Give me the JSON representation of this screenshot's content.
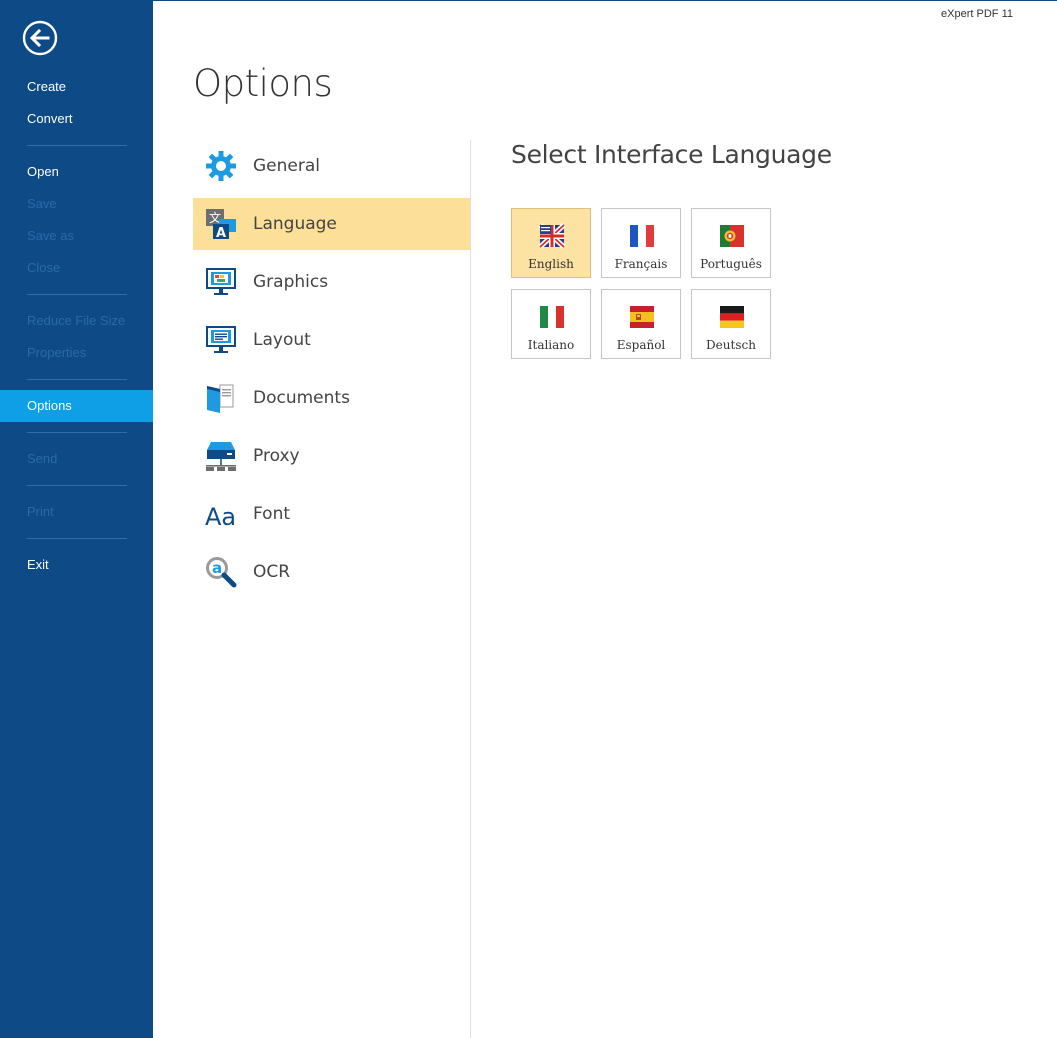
{
  "app": {
    "brand": "eXpert PDF 11",
    "page_title": "Options"
  },
  "sidebar": {
    "items": [
      {
        "label": "Create",
        "enabled": true
      },
      {
        "label": "Convert",
        "enabled": true
      },
      {
        "label": "Open",
        "enabled": true
      },
      {
        "label": "Save",
        "enabled": false
      },
      {
        "label": "Save as",
        "enabled": false
      },
      {
        "label": "Close",
        "enabled": false
      },
      {
        "label": "Reduce File Size",
        "enabled": false
      },
      {
        "label": "Properties",
        "enabled": false
      },
      {
        "label": "Options",
        "enabled": true,
        "active": true
      },
      {
        "label": "Send",
        "enabled": false
      },
      {
        "label": "Print",
        "enabled": false
      },
      {
        "label": "Exit",
        "enabled": true
      }
    ]
  },
  "categories": {
    "items": [
      {
        "label": "General",
        "icon": "gear-icon"
      },
      {
        "label": "Language",
        "icon": "language-icon",
        "active": true
      },
      {
        "label": "Graphics",
        "icon": "graphics-monitor-icon"
      },
      {
        "label": "Layout",
        "icon": "layout-monitor-icon"
      },
      {
        "label": "Documents",
        "icon": "documents-icon"
      },
      {
        "label": "Proxy",
        "icon": "proxy-server-icon"
      },
      {
        "label": "Font",
        "icon": "font-icon"
      },
      {
        "label": "OCR",
        "icon": "ocr-magnifier-icon"
      }
    ],
    "font_icon_text": "Aa",
    "language_icon_top": "文",
    "language_icon_bottom": "A",
    "ocr_icon_letter": "a"
  },
  "language_panel": {
    "heading": "Select Interface Language",
    "languages": [
      {
        "label": "English",
        "flag": "uk-flag-icon",
        "selected": true
      },
      {
        "label": "Français",
        "flag": "france-flag-icon"
      },
      {
        "label": "Português",
        "flag": "portugal-flag-icon"
      },
      {
        "label": "Italiano",
        "flag": "italy-flag-icon"
      },
      {
        "label": "Español",
        "flag": "spain-flag-icon"
      },
      {
        "label": "Deutsch",
        "flag": "germany-flag-icon"
      }
    ]
  },
  "colors": {
    "sidebar_bg": "#0d4a86",
    "sidebar_active": "#0f9fe6",
    "category_active": "#fce09a",
    "tile_selected": "#fce3a3",
    "icon_blue": "#1e9be0"
  }
}
